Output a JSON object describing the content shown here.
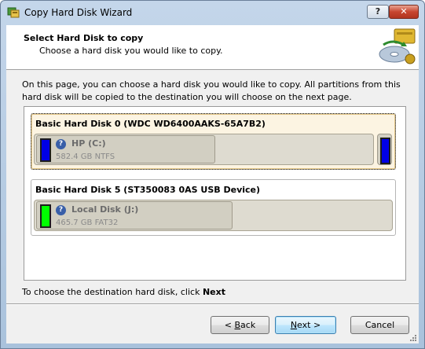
{
  "window": {
    "title": "Copy Hard Disk Wizard",
    "help_label": "?",
    "close_label": "✕"
  },
  "header": {
    "title": "Select Hard Disk to copy",
    "subtitle": "Choose a hard disk you would like to copy."
  },
  "description": "On this page, you can choose a hard disk you would like to copy. All partitions from this hard disk will be copied to the destination you will choose on the next page.",
  "disks": [
    {
      "title": "Basic Hard Disk 0 (WDC WD6400AAKS-65A7B2)",
      "selected": true,
      "partition": {
        "name": "HP (C:)",
        "info": "582.4 GB NTFS",
        "color": "#0000e6"
      },
      "side_partition_color": "#0000e6"
    },
    {
      "title": "Basic Hard Disk 5 (ST350083 0AS USB Device)",
      "selected": false,
      "partition": {
        "name": "Local Disk (J:)",
        "info": "465.7 GB FAT32",
        "color": "#00ff00"
      }
    }
  ],
  "footer": {
    "prefix": "To choose the destination hard disk, click ",
    "emphasis": "Next"
  },
  "buttons": {
    "back": {
      "pre": "< ",
      "accel": "B",
      "rest": "ack"
    },
    "next": {
      "pre": "",
      "accel": "N",
      "rest": "ext >"
    },
    "cancel": {
      "label": "Cancel"
    }
  }
}
